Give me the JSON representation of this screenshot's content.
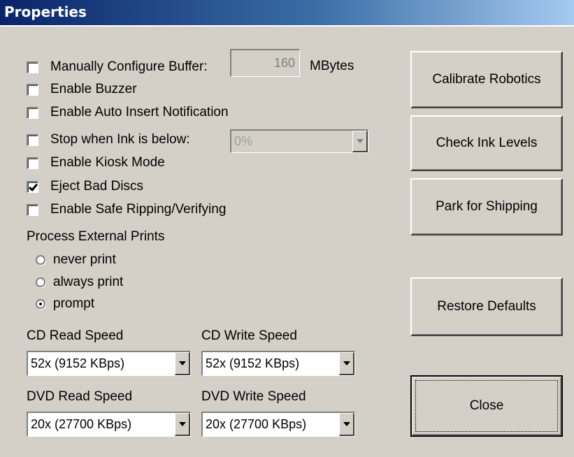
{
  "window": {
    "title": "Properties"
  },
  "options": {
    "manual_buffer": {
      "label": "Manually Configure Buffer:",
      "checked": false,
      "value": "160",
      "unit": "MBytes"
    },
    "enable_buzzer": {
      "label": "Enable Buzzer",
      "checked": false
    },
    "auto_insert": {
      "label": "Enable Auto Insert Notification",
      "checked": false
    },
    "stop_ink": {
      "label": "Stop when Ink is below:",
      "checked": false,
      "value": "0%"
    },
    "kiosk": {
      "label": "Enable Kiosk Mode",
      "checked": false
    },
    "eject_bad": {
      "label": "Eject Bad Discs",
      "checked": true
    },
    "safe_ripping": {
      "label": "Enable Safe Ripping/Verifying",
      "checked": false
    }
  },
  "external_prints": {
    "label": "Process External Prints",
    "choices": [
      "never print",
      "always print",
      "prompt"
    ],
    "selected": "prompt"
  },
  "speeds": {
    "cd_read": {
      "label": "CD Read Speed",
      "value": "52x (9152 KBps)"
    },
    "cd_write": {
      "label": "CD Write Speed",
      "value": "52x (9152 KBps)"
    },
    "dvd_read": {
      "label": "DVD Read Speed",
      "value": "20x (27700 KBps)"
    },
    "dvd_write": {
      "label": "DVD Write Speed",
      "value": "20x (27700 KBps)"
    }
  },
  "buttons": {
    "calibrate": "Calibrate Robotics",
    "check_ink": "Check Ink Levels",
    "park": "Park for Shipping",
    "restore": "Restore Defaults",
    "close": "Close"
  }
}
